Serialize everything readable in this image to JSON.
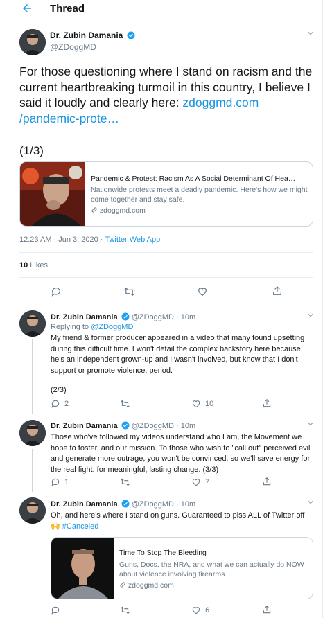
{
  "header": {
    "back_icon": "arrow-left-icon",
    "title": "Thread"
  },
  "main_tweet": {
    "author_name": "Dr. Zubin Damania",
    "author_handle": "@ZDoggMD",
    "text_before_link": "For those questioning where I stand on racism and the current heartbreaking turmoil in this country, I believe I said it loudly and clearly here: ",
    "link_line1": "zdoggmd.com",
    "link_line2": "/pandemic-prote…",
    "counter": "(1/3)",
    "card": {
      "title": "Pandemic & Protest: Racism As A Social Determinant Of Hea…",
      "description": "Nationwide protests meet a deadly pandemic. Here's how we might come together and stay safe.",
      "domain": "zdoggmd.com"
    },
    "timestamp": "12:23 AM · Jun 3, 2020 · ",
    "source_app": "Twitter Web App",
    "likes_count": "10",
    "likes_label": " Likes"
  },
  "replies": [
    {
      "author_name": "Dr. Zubin Damania",
      "handle_time": "@ZDoggMD · 10m",
      "replying_label": "Replying to ",
      "replying_handle": "@ZDoggMD",
      "text": "My friend & former producer appeared in a video that many found upsetting during this difficult time. I won't detail the complex backstory here because he's an independent grown-up and I wasn't involved, but know that I don't support or promote violence, period.",
      "counter": "(2/3)",
      "reply_count": "2",
      "retweet_count": "",
      "like_count": "10"
    },
    {
      "author_name": "Dr. Zubin Damania",
      "handle_time": "@ZDoggMD · 10m",
      "text": "Those who've followed my videos understand who I am, the Movement we hope to foster, and our mission. To those who wish to \"call out\" perceived evil and generate more outrage, you won't be convinced, so we'll save energy for the real fight: for meaningful, lasting change. (3/3)",
      "reply_count": "1",
      "retweet_count": "",
      "like_count": "7"
    },
    {
      "author_name": "Dr. Zubin Damania",
      "handle_time": "@ZDoggMD · 10m",
      "text": "Oh, and here's where I stand on guns. Guaranteed to piss ALL of Twitter off ",
      "emoji": "🙌",
      "hashtag": "#Canceled",
      "card": {
        "title": "Time To Stop The Bleeding",
        "description": "Guns, Docs, the NRA, and what we can actually do NOW about violence involving firearms.",
        "domain": "zdoggmd.com"
      },
      "reply_count": "",
      "retweet_count": "",
      "like_count": "6"
    }
  ],
  "colors": {
    "accent": "#1da1f2",
    "link": "#1b95e0",
    "muted": "#657786",
    "border": "#e6ecf0"
  }
}
